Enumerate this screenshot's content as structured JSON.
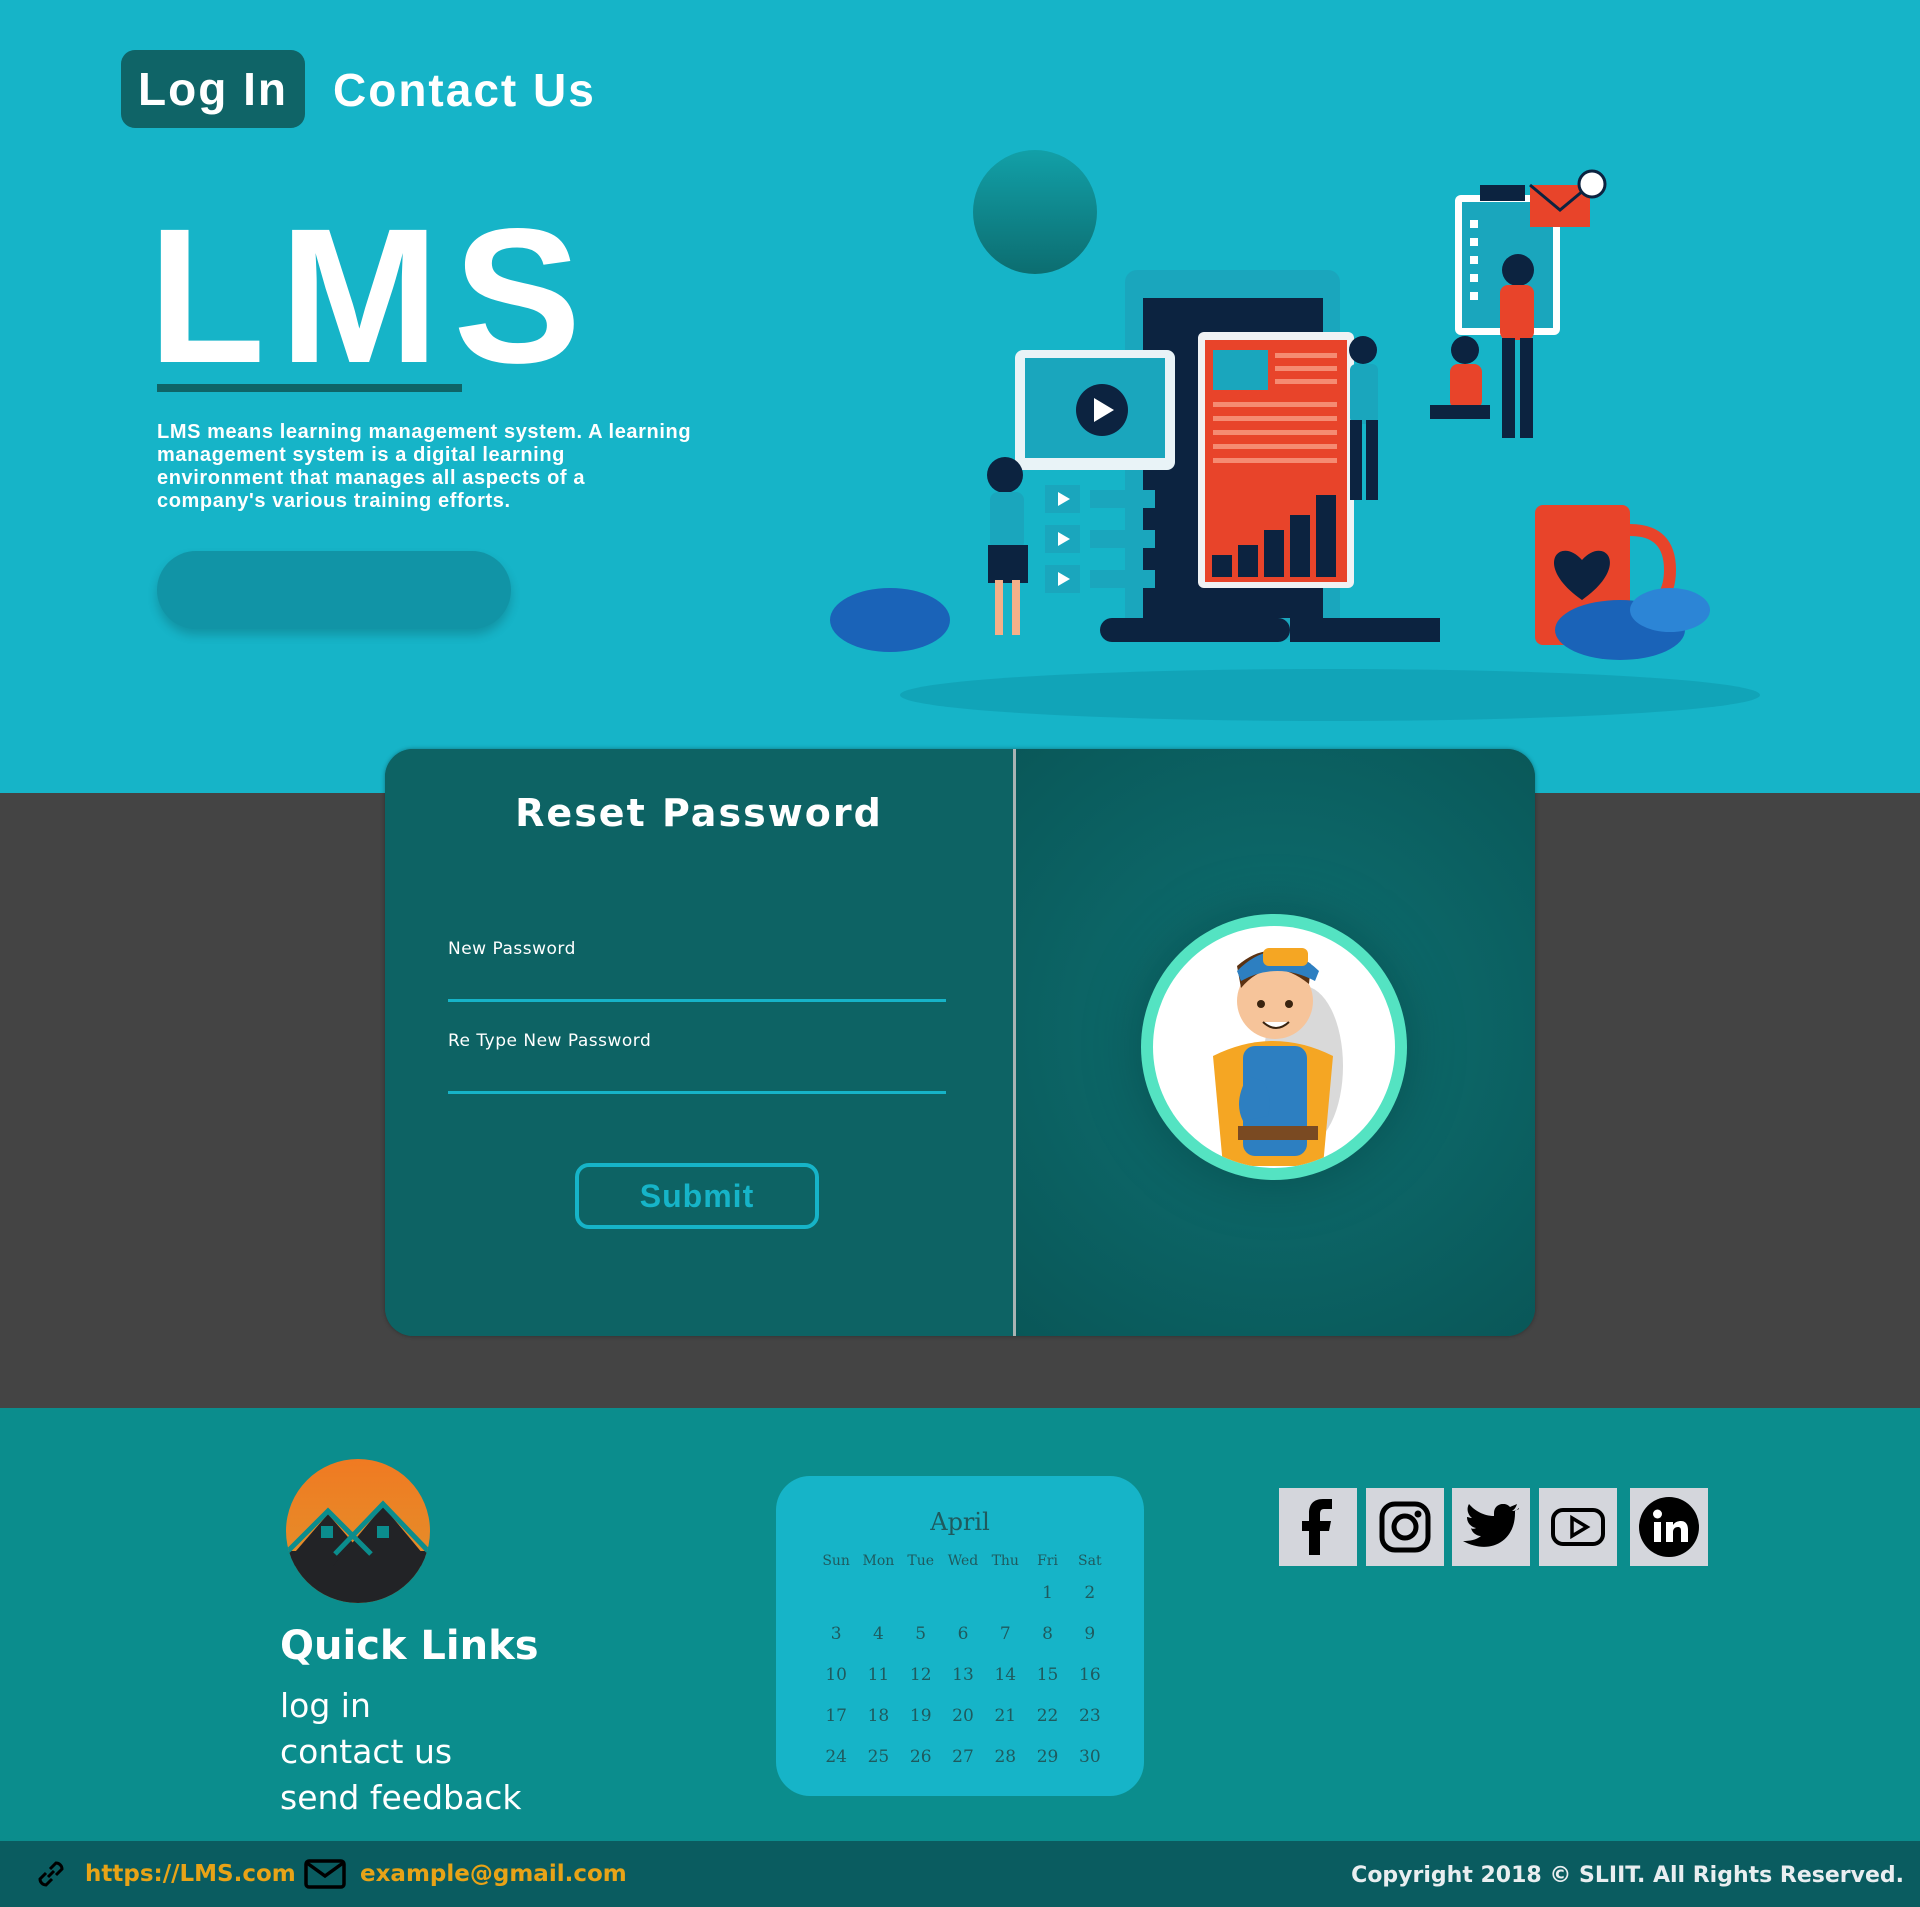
{
  "nav": {
    "login": "Log In",
    "contact": "Contact Us"
  },
  "hero": {
    "title": "LMS",
    "description": "LMS means learning management system. A learning management system is a digital learning environment that manages all aspects of a company's various training efforts.",
    "illustration": "e-learning-illustration"
  },
  "reset": {
    "title": "Reset Password",
    "new_password_label": "New Password",
    "retype_label": "Re Type New Password",
    "new_password_value": "",
    "retype_value": "",
    "submit": "Submit",
    "avatar": "worker-avatar"
  },
  "footer": {
    "quick_links_title": "Quick Links",
    "links": [
      "log in",
      "contact us",
      "send feedback"
    ],
    "calendar": {
      "month": "April",
      "days": [
        "Sun",
        "Mon",
        "Tue",
        "Wed",
        "Thu",
        "Fri",
        "Sat"
      ],
      "weeks": [
        [
          "",
          "",
          "",
          "",
          "",
          "1",
          "2"
        ],
        [
          "3",
          "4",
          "5",
          "6",
          "7",
          "8",
          "9"
        ],
        [
          "10",
          "11",
          "12",
          "13",
          "14",
          "15",
          "16"
        ],
        [
          "17",
          "18",
          "19",
          "20",
          "21",
          "22",
          "23"
        ],
        [
          "24",
          "25",
          "26",
          "27",
          "28",
          "29",
          "30"
        ]
      ]
    },
    "social": [
      "facebook-icon",
      "instagram-icon",
      "twitter-icon",
      "youtube-icon",
      "linkedin-icon"
    ]
  },
  "bottom_bar": {
    "url": "https://LMS.com",
    "email": "example@gmail.com",
    "copyright": "Copyright 2018 © SLIIT. All Rights Reserved."
  },
  "colors": {
    "hero_bg": "#16b4c8",
    "dark_teal": "#0f6467",
    "middle_bg": "#444444",
    "footer_bg": "#0b8d8d",
    "accent_orange": "#e8a317"
  }
}
